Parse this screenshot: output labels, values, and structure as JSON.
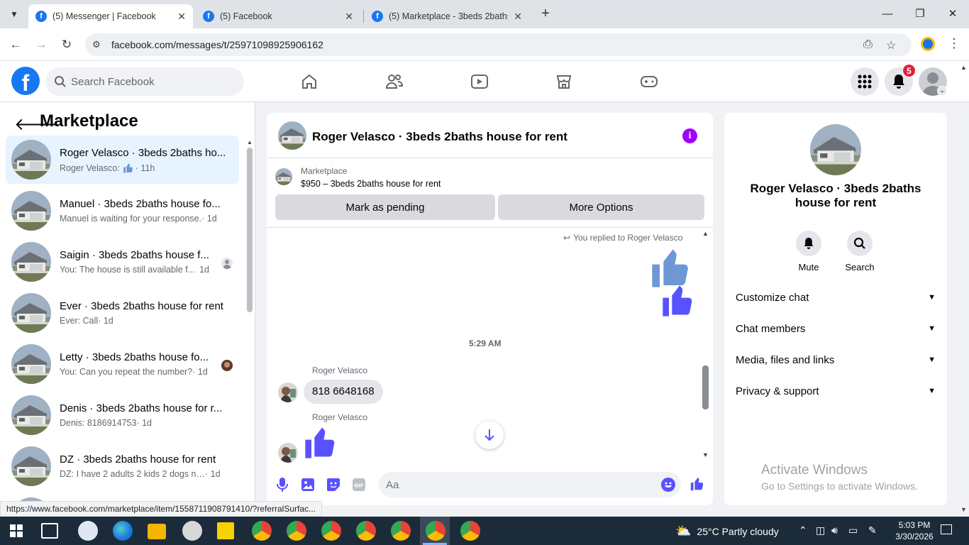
{
  "browser": {
    "tabs": [
      {
        "title": "(5) Messenger | Facebook",
        "active": true
      },
      {
        "title": "(5) Facebook",
        "active": false
      },
      {
        "title": "(5) Marketplace - 3beds 2baths",
        "active": false
      }
    ],
    "url": "facebook.com/messages/t/25971098925906162",
    "status_url": "https://www.facebook.com/marketplace/item/1558711908791410/?referralSurfac..."
  },
  "header": {
    "search_placeholder": "Search Facebook",
    "notification_count": "5",
    "accent": "#1877f2"
  },
  "sidebar": {
    "title": "Marketplace",
    "conversations": [
      {
        "name": "Roger Velasco · 3beds 2baths ho...",
        "preview": "Roger Velasco:",
        "time": "· 11h",
        "active": true
      },
      {
        "name": "Manuel · 3beds 2baths house fo...",
        "preview": "Manuel is waiting for your response.",
        "time": "· 1d"
      },
      {
        "name": "Saigin · 3beds 2baths house f...",
        "preview": "You: The house is still available f...",
        "time": "1d"
      },
      {
        "name": "Ever · 3beds 2baths house for rent",
        "preview": "Ever: Call",
        "time": "· 1d"
      },
      {
        "name": "Letty · 3beds 2baths house fo...",
        "preview": "You: Can you repeat the number?",
        "time": "· 1d"
      },
      {
        "name": "Denis · 3beds 2baths house for r...",
        "preview": "Denis: 8186914753",
        "time": "· 1d"
      },
      {
        "name": "DZ · 3beds 2baths house for rent",
        "preview": "DZ: I have 2 adults 2 kids 2 dogs n ...",
        "time": "· 1d"
      }
    ]
  },
  "chat": {
    "title": "Roger Velasco · 3beds 2baths house for rent",
    "marketplace_label": "Marketplace",
    "listing": "$950 – 3beds 2baths house for rent",
    "mark_pending": "Mark as pending",
    "more_options": "More Options",
    "reply_note": "You replied to Roger Velasco",
    "timestamp": "5:29 AM",
    "sender_1": "Roger Velasco",
    "message_1": "818 6648168",
    "sender_2": "Roger Velasco",
    "composer_placeholder": "Aa",
    "like_color": "#5851ff"
  },
  "details": {
    "name": "Roger Velasco · 3beds 2baths house for rent",
    "mute": "Mute",
    "search": "Search",
    "sections": [
      "Customize chat",
      "Chat members",
      "Media, files and links",
      "Privacy & support"
    ]
  },
  "watermark": {
    "line1": "Activate Windows",
    "line2": "Go to Settings to activate Windows."
  },
  "taskbar": {
    "weather": "25°C  Partly cloudy",
    "time": "5:03 PM",
    "date": "3/30/2026"
  }
}
